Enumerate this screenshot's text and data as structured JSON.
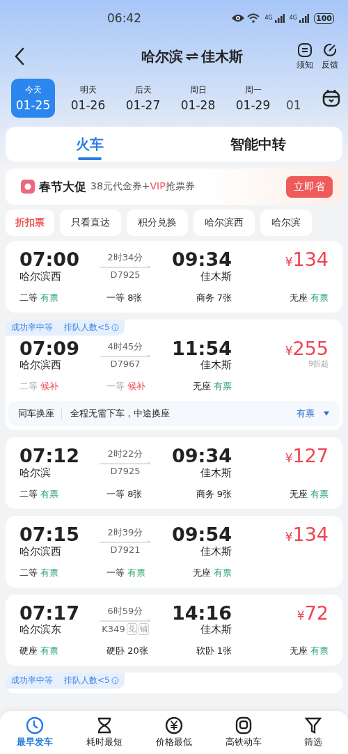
{
  "status_bar": {
    "time": "06:42",
    "networks": [
      "4G",
      "4G"
    ],
    "battery": "100"
  },
  "header": {
    "from": "哈尔滨",
    "to": "佳木斯",
    "actions": [
      {
        "label": "须知",
        "kind": "notice"
      },
      {
        "label": "反馈",
        "kind": "feedback"
      }
    ]
  },
  "dates": [
    {
      "weekday": "今天",
      "date": "01-25",
      "selected": true
    },
    {
      "weekday": "明天",
      "date": "01-26",
      "selected": false
    },
    {
      "weekday": "后天",
      "date": "01-27",
      "selected": false
    },
    {
      "weekday": "周日",
      "date": "01-28",
      "selected": false
    },
    {
      "weekday": "周一",
      "date": "01-29",
      "selected": false
    },
    {
      "date": "01",
      "selected": false
    }
  ],
  "tabs": [
    {
      "label": "火车",
      "selected": true
    },
    {
      "label": "智能中转",
      "selected": false
    }
  ],
  "promo": {
    "title": "春节大促",
    "subtitle": [
      {
        "text": "38元代金券+",
        "accent": false
      },
      {
        "text": "VIP",
        "accent": true
      },
      {
        "text": "抢票券",
        "accent": false
      }
    ],
    "button": "立即省"
  },
  "filters": [
    {
      "label": "折扣票",
      "selected": true
    },
    {
      "label": "只看直达",
      "selected": false
    },
    {
      "label": "积分兑换",
      "selected": false
    },
    {
      "label": "哈尔滨西",
      "selected": false
    },
    {
      "label": "哈尔滨",
      "selected": false
    }
  ],
  "trains": [
    {
      "depart": "07:00",
      "from": "哈尔滨西",
      "duration": "2时34分",
      "number": "D7925",
      "arrive": "09:34",
      "to": "佳木斯",
      "currency": "¥",
      "price": "134",
      "seats": [
        {
          "class": "二等",
          "status": "有票",
          "kind": "available"
        },
        {
          "class": "一等",
          "status": "8张",
          "kind": "count"
        },
        {
          "class": "商务",
          "status": "7张",
          "kind": "count"
        },
        {
          "class": "无座",
          "status": "有票",
          "kind": "available"
        }
      ]
    },
    {
      "tags": [
        "成功率中等",
        "排队人数<5"
      ],
      "depart": "07:09",
      "from": "哈尔滨西",
      "duration": "4时45分",
      "number": "D7967",
      "arrive": "11:54",
      "to": "佳木斯",
      "currency": "¥",
      "price": "255",
      "discount": "9折起",
      "seats": [
        {
          "class": "二等",
          "status": "候补",
          "kind": "waitlist"
        },
        {
          "class": "一等",
          "status": "候补",
          "kind": "waitlist"
        },
        {
          "class": "无座",
          "status": "有票",
          "kind": "available"
        }
      ],
      "seat_change": {
        "title": "同车换座",
        "text": "全程无需下车，中途换座",
        "status": "有票"
      }
    },
    {
      "depart": "07:12",
      "from": "哈尔滨",
      "duration": "2时22分",
      "number": "D7925",
      "arrive": "09:34",
      "to": "佳木斯",
      "currency": "¥",
      "price": "127",
      "seats": [
        {
          "class": "二等",
          "status": "有票",
          "kind": "available"
        },
        {
          "class": "一等",
          "status": "8张",
          "kind": "count"
        },
        {
          "class": "商务",
          "status": "9张",
          "kind": "count"
        },
        {
          "class": "无座",
          "status": "有票",
          "kind": "available"
        }
      ]
    },
    {
      "depart": "07:15",
      "from": "哈尔滨西",
      "duration": "2时39分",
      "number": "D7921",
      "arrive": "09:54",
      "to": "佳木斯",
      "currency": "¥",
      "price": "134",
      "seats": [
        {
          "class": "二等",
          "status": "有票",
          "kind": "available"
        },
        {
          "class": "一等",
          "status": "有票",
          "kind": "available"
        },
        {
          "class": "无座",
          "status": "有票",
          "kind": "available"
        }
      ]
    },
    {
      "depart": "07:17",
      "from": "哈尔滨东",
      "duration": "6时59分",
      "number": "K349",
      "badges": [
        "兑",
        "铺"
      ],
      "arrive": "14:16",
      "to": "佳木斯",
      "currency": "¥",
      "price": "72",
      "seats": [
        {
          "class": "硬座",
          "status": "有票",
          "kind": "available"
        },
        {
          "class": "硬卧",
          "status": "20张",
          "kind": "count"
        },
        {
          "class": "软卧",
          "status": "1张",
          "kind": "count"
        },
        {
          "class": "无座",
          "status": "有票",
          "kind": "available"
        }
      ]
    }
  ],
  "partial_card": {
    "tags": [
      "成功率中等",
      "排队人数<5"
    ]
  },
  "bottom_nav": [
    {
      "label": "最早发车",
      "kind": "clock",
      "selected": true
    },
    {
      "label": "耗时最短",
      "kind": "duration",
      "selected": false
    },
    {
      "label": "价格最低",
      "kind": "price",
      "selected": false
    },
    {
      "label": "高铁动车",
      "kind": "train",
      "selected": false
    },
    {
      "label": "筛选",
      "kind": "filter",
      "selected": false
    }
  ]
}
